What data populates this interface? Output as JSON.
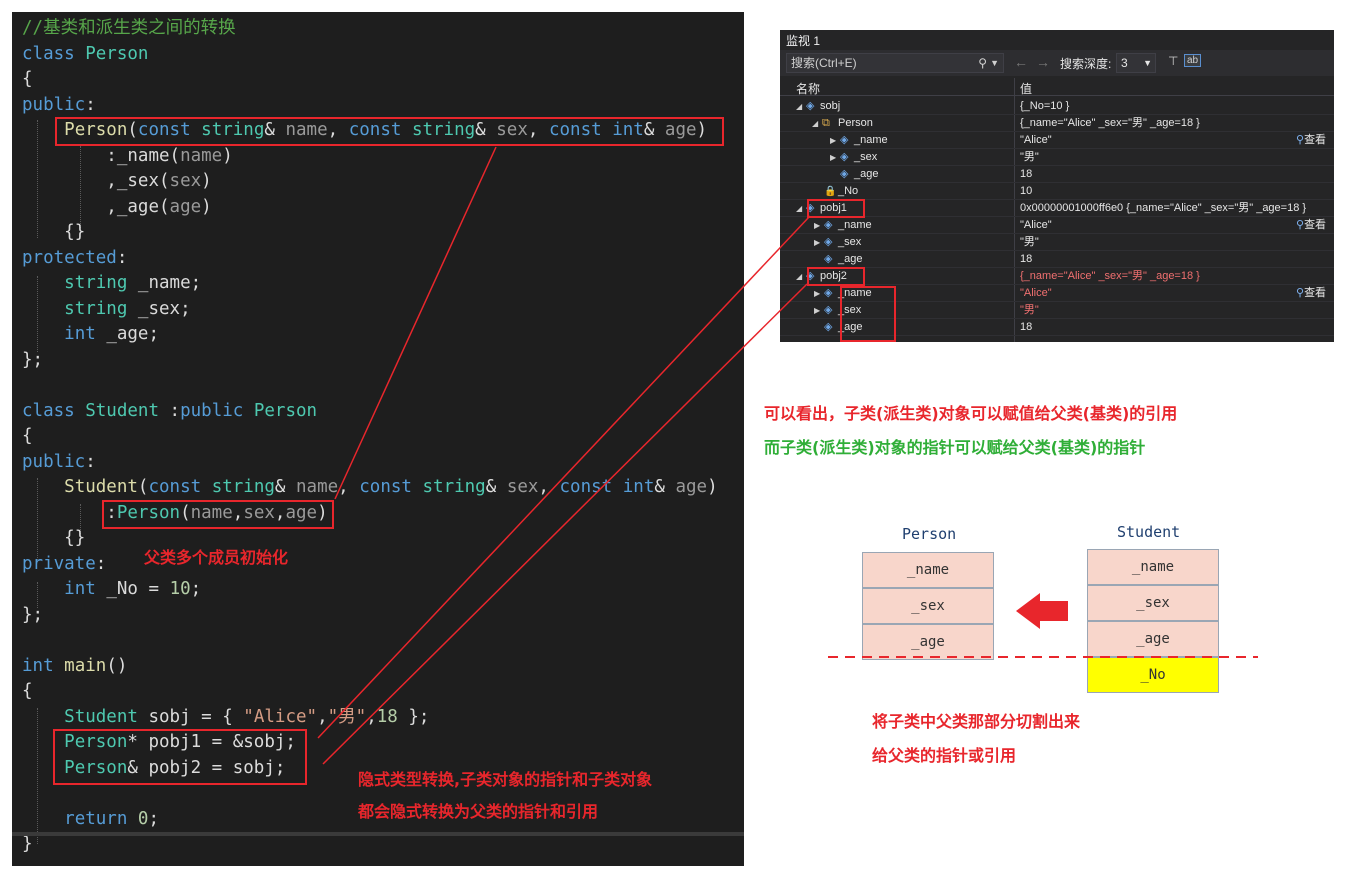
{
  "code": {
    "lines": [
      "//基类和派生类之间的转换",
      "class Person",
      "{",
      "public:",
      "    Person(const string& name, const string& sex, const int& age)",
      "        :_name(name)",
      "        ,_sex(sex)",
      "        ,_age(age)",
      "    {}",
      "protected:",
      "    string _name;",
      "    string _sex;",
      "    int _age;",
      "};",
      "",
      "class Student :public Person",
      "{",
      "public:",
      "    Student(const string& name, const string& sex, const int& age)",
      "        :Person(name,sex,age)",
      "    {}",
      "private:",
      "    int _No = 10;",
      "};",
      "",
      "int main()",
      "{",
      "    Student sobj = { \"Alice\",\"男\",18 };",
      "    Person* pobj1 = &sobj;",
      "    Person& pobj2 = sobj;",
      "",
      "    return 0;",
      "}"
    ]
  },
  "watch": {
    "title": "监视 1",
    "search_placeholder": "搜索(Ctrl+E)",
    "search_depth_label": "搜索深度:",
    "search_depth_value": "3",
    "col_name": "名称",
    "col_value": "值",
    "view_label": "查看",
    "rows": [
      {
        "name": "sobj",
        "value": "{_No=10 }"
      },
      {
        "name": "Person",
        "value": "{_name=\"Alice\" _sex=\"男\" _age=18 }"
      },
      {
        "name": "_name",
        "value": "\"Alice\""
      },
      {
        "name": "_sex",
        "value": "\"男\""
      },
      {
        "name": "_age",
        "value": "18"
      },
      {
        "name": "_No",
        "value": "10"
      },
      {
        "name": "pobj1",
        "value": "0x00000001000ff6e0 {_name=\"Alice\" _sex=\"男\" _age=18 }"
      },
      {
        "name": "_name",
        "value": "\"Alice\""
      },
      {
        "name": "_sex",
        "value": "\"男\""
      },
      {
        "name": "_age",
        "value": "18"
      },
      {
        "name": "pobj2",
        "value": "{_name=\"Alice\" _sex=\"男\" _age=18 }"
      },
      {
        "name": "_name",
        "value": "\"Alice\""
      },
      {
        "name": "_sex",
        "value": "\"男\""
      },
      {
        "name": "_age",
        "value": "18"
      }
    ]
  },
  "notes": {
    "init_note": "父类多个成员初始化",
    "implicit_line1": "隐式类型转换,子类对象的指针和子类对象",
    "implicit_line2": "都会隐式转换为父类的指针和引用",
    "ref_note": "可以看出，子类(派生类)对象可以赋值给父类(基类)的引用",
    "ptr_note": "而子类(派生类)对象的指针可以赋给父类(基类)的指针",
    "slice_line1": "将子类中父类那部分切割出来",
    "slice_line2": "给父类的指针或引用"
  },
  "diagram": {
    "person_title": "Person",
    "student_title": "Student",
    "person_fields": [
      "_name",
      "_sex",
      "_age"
    ],
    "student_fields": [
      "_name",
      "_sex",
      "_age",
      "_No"
    ],
    "colors": {
      "field": "#f8d6cb",
      "extra_field": "#ffff00",
      "arrow": "#e8262c",
      "cut_line": "#e8262c"
    }
  }
}
